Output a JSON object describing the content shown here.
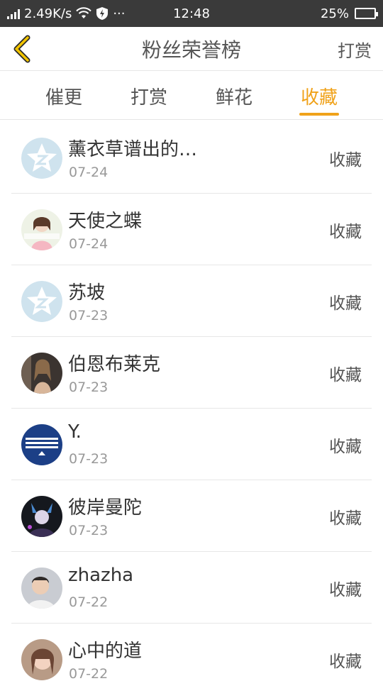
{
  "status_bar": {
    "network_speed": "2.49K/s",
    "time": "12:48",
    "battery": "25%",
    "more": "···"
  },
  "header": {
    "title": "粉丝荣誉榜",
    "right_action": "打赏"
  },
  "tabs": [
    {
      "label": "催更",
      "active": false
    },
    {
      "label": "打赏",
      "active": false
    },
    {
      "label": "鲜花",
      "active": false
    },
    {
      "label": "收藏",
      "active": true
    }
  ],
  "colors": {
    "accent": "#f0a21a",
    "status_bar_bg": "#3a3a3a",
    "default_avatar": "#cfe3ee"
  },
  "fans": [
    {
      "name": "薰衣草谱出的…",
      "date": "07-24",
      "action": "收藏",
      "avatar": "qq-star-default-icon"
    },
    {
      "name": "天使之蝶",
      "date": "07-24",
      "action": "收藏",
      "avatar": "user-photo"
    },
    {
      "name": "苏坡",
      "date": "07-23",
      "action": "收藏",
      "avatar": "qq-star-default-icon"
    },
    {
      "name": "伯恩布莱克",
      "date": "07-23",
      "action": "收藏",
      "avatar": "user-photo"
    },
    {
      "name": "Y.",
      "date": "07-23",
      "action": "收藏",
      "avatar": "user-photo"
    },
    {
      "name": "彼岸曼陀",
      "date": "07-23",
      "action": "收藏",
      "avatar": "user-photo"
    },
    {
      "name": "zhazha",
      "date": "07-22",
      "action": "收藏",
      "avatar": "user-photo"
    },
    {
      "name": "心中的道",
      "date": "07-22",
      "action": "收藏",
      "avatar": "user-photo"
    }
  ]
}
